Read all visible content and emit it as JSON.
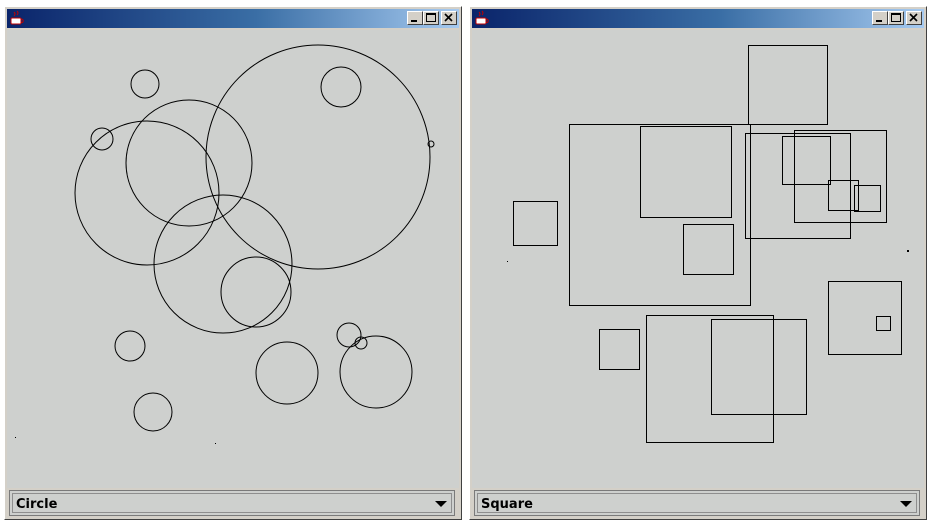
{
  "windows": [
    {
      "id": "left",
      "selector_value": "Circle",
      "shapes_type": "circle",
      "colors": {
        "title_start": "#0a246a",
        "title_end": "#a6caf0",
        "canvas": "#ced0ce"
      }
    },
    {
      "id": "right",
      "selector_value": "Square",
      "shapes_type": "square",
      "colors": {
        "title_start": "#0a246a",
        "title_end": "#a6caf0",
        "canvas": "#ced0ce"
      }
    }
  ],
  "icons": [
    "java-app-icon",
    "minimize-icon",
    "maximize-icon",
    "close-icon",
    "dropdown-arrow-icon"
  ]
}
